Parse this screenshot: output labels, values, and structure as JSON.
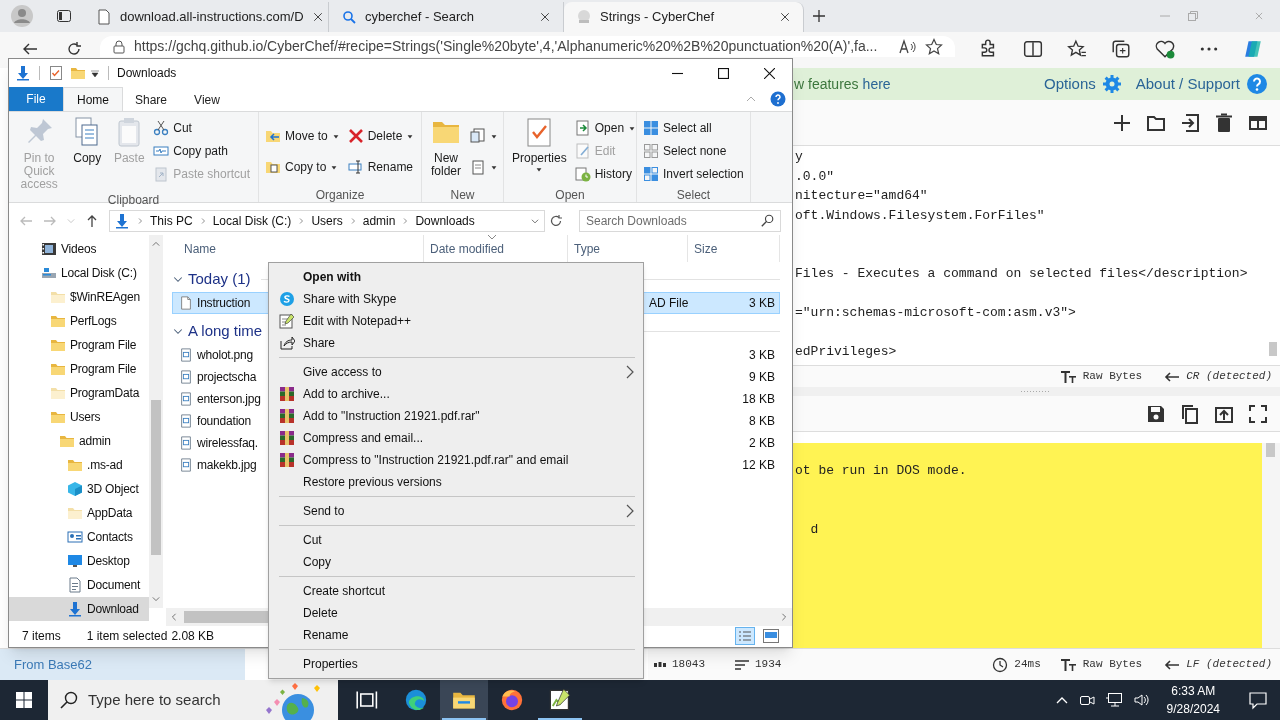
{
  "browser": {
    "tabs": [
      {
        "title": "download.all-instructions.com/D",
        "selected": false
      },
      {
        "title": "cyberchef - Search",
        "selected": false
      },
      {
        "title": "Strings - CyberChef",
        "selected": true
      }
    ],
    "url": "https://gchq.github.io/CyberChef/#recipe=Strings('Single%20byte',4,'Alphanumeric%20%2B%20punctuation%20(A)',fa..."
  },
  "cyberchef": {
    "banner": {
      "text": "w features",
      "link": "here"
    },
    "options": "Options",
    "about": "About / Support",
    "input": {
      "text": "y\n.0.0\"\nnitecture=\"amd64\"\noft.Windows.Filesystem.ForFiles\"\n\n\nFiles - Executes a command on selected files</description>\n\n=\"urn:schemas-microsoft-com:asm.v3\">\n\nedPrivileges>"
    },
    "input_status": {
      "format": "Raw Bytes",
      "eol": "CR (detected)"
    },
    "output": {
      "text": "ot be run in DOS mode.\n\n\n  d"
    },
    "output_status": {
      "length": "18043",
      "lines": "1934",
      "time": "24ms",
      "format": "Raw Bytes",
      "eol": "LF (detected)"
    },
    "recipe_op": "From Base62"
  },
  "explorer": {
    "title": "Downloads",
    "ribbon_tabs": [
      {
        "label": "File",
        "selected": false,
        "kind": "file"
      },
      {
        "label": "Home",
        "selected": true,
        "kind": "tab"
      },
      {
        "label": "Share",
        "selected": false,
        "kind": "tab"
      },
      {
        "label": "View",
        "selected": false,
        "kind": "tab"
      }
    ],
    "groups": [
      {
        "label": "Clipboard",
        "items": [
          {
            "label": "Pin to Quick access",
            "kind": "large",
            "disabled": true,
            "dropdown": false
          },
          {
            "label": "Copy",
            "kind": "large",
            "disabled": false,
            "dropdown": false
          },
          {
            "label": "Paste",
            "kind": "large",
            "disabled": true,
            "dropdown": false
          },
          {
            "label": "Cut",
            "kind": "small",
            "disabled": false,
            "dropdown": false
          },
          {
            "label": "Copy path",
            "kind": "small",
            "disabled": false,
            "dropdown": false
          },
          {
            "label": "Paste shortcut",
            "kind": "small",
            "disabled": true,
            "dropdown": false
          }
        ]
      },
      {
        "label": "Organize",
        "items": [
          {
            "label": "Move to",
            "kind": "small",
            "disabled": false,
            "dropdown": true
          },
          {
            "label": "Copy to",
            "kind": "small",
            "disabled": false,
            "dropdown": true
          },
          {
            "label": "Delete",
            "kind": "small",
            "disabled": false,
            "dropdown": true
          },
          {
            "label": "Rename",
            "kind": "small",
            "disabled": false,
            "dropdown": false
          }
        ]
      },
      {
        "label": "New",
        "items": [
          {
            "label": "New folder",
            "kind": "large",
            "disabled": false,
            "dropdown": false
          },
          {
            "kind": "icon",
            "disabled": false,
            "dropdown": true
          },
          {
            "kind": "icon",
            "disabled": false,
            "dropdown": true
          }
        ]
      },
      {
        "label": "Open",
        "items": [
          {
            "label": "Properties",
            "kind": "large",
            "disabled": false,
            "dropdown": true
          },
          {
            "label": "Open",
            "kind": "small",
            "disabled": false,
            "dropdown": true
          },
          {
            "label": "Edit",
            "kind": "small",
            "disabled": true,
            "dropdown": false
          },
          {
            "label": "History",
            "kind": "small",
            "disabled": false,
            "dropdown": false
          }
        ]
      },
      {
        "label": "Select",
        "items": [
          {
            "label": "Select all",
            "kind": "small",
            "disabled": false,
            "dropdown": false
          },
          {
            "label": "Select none",
            "kind": "small",
            "disabled": false,
            "dropdown": false
          },
          {
            "label": "Invert selection",
            "kind": "small",
            "disabled": false,
            "dropdown": false
          }
        ]
      }
    ],
    "path": [
      "This PC",
      "Local Disk (C:)",
      "Users",
      "admin",
      "Downloads"
    ],
    "search": {
      "placeholder": "Search Downloads"
    },
    "tree": [
      {
        "label": "Videos",
        "selected": false,
        "hidden": false
      },
      {
        "label": "Local Disk (C:)",
        "selected": false,
        "hidden": false,
        "children": [
          {
            "label": "$WinREAgen",
            "selected": false,
            "hidden": true
          },
          {
            "label": "PerfLogs",
            "selected": false,
            "hidden": false
          },
          {
            "label": "Program File",
            "selected": false,
            "hidden": false
          },
          {
            "label": "Program File",
            "selected": false,
            "hidden": false
          },
          {
            "label": "ProgramData",
            "selected": false,
            "hidden": true
          },
          {
            "label": "Users",
            "selected": false,
            "hidden": false,
            "children": [
              {
                "label": "admin",
                "selected": false,
                "hidden": false,
                "children": [
                  {
                    "label": ".ms-ad",
                    "selected": false,
                    "hidden": false
                  },
                  {
                    "label": "3D Object",
                    "selected": false,
                    "hidden": false
                  },
                  {
                    "label": "AppData",
                    "selected": false,
                    "hidden": true
                  },
                  {
                    "label": "Contacts",
                    "selected": false,
                    "hidden": false
                  },
                  {
                    "label": "Desktop",
                    "selected": false,
                    "hidden": false
                  },
                  {
                    "label": "Document",
                    "selected": false,
                    "hidden": false
                  },
                  {
                    "label": "Download",
                    "selected": true,
                    "hidden": false
                  }
                ]
              }
            ]
          }
        ]
      }
    ],
    "columns": [
      "Name",
      "Date modified",
      "Type",
      "Size"
    ],
    "file_groups": [
      {
        "label": "Today (1)",
        "rows": [
          {
            "name": "Instruction",
            "type": "AD File",
            "size": "3 KB",
            "selected": true
          }
        ]
      },
      {
        "label": "A long time",
        "rows": [
          {
            "name": "wholot.png",
            "size": "3 KB",
            "selected": false
          },
          {
            "name": "projectscha",
            "size": "9 KB",
            "selected": false
          },
          {
            "name": "enterson.jpg",
            "size": "18 KB",
            "selected": false
          },
          {
            "name": "foundation",
            "size": "8 KB",
            "selected": false
          },
          {
            "name": "wirelessfaq.",
            "size": "2 KB",
            "selected": false
          },
          {
            "name": "makekb.jpg",
            "size": "12 KB",
            "selected": false
          }
        ]
      }
    ],
    "status": {
      "count": "7 items",
      "selection": "1 item selected",
      "size": "2.08 KB"
    }
  },
  "context_menu": [
    {
      "kind": "item",
      "label": "Open with",
      "default": true,
      "submenu": false
    },
    {
      "kind": "item",
      "label": "Share with Skype",
      "default": false,
      "submenu": false
    },
    {
      "kind": "item",
      "label": "Edit with Notepad++",
      "default": false,
      "submenu": false
    },
    {
      "kind": "item",
      "label": "Share",
      "default": false,
      "submenu": false
    },
    {
      "kind": "separator"
    },
    {
      "kind": "item",
      "label": "Give access to",
      "default": false,
      "submenu": true
    },
    {
      "kind": "item",
      "label": "Add to archive...",
      "default": false,
      "submenu": false
    },
    {
      "kind": "item",
      "label": "Add to \"Instruction 21921.pdf.rar\"",
      "default": false,
      "submenu": false
    },
    {
      "kind": "item",
      "label": "Compress and email...",
      "default": false,
      "submenu": false
    },
    {
      "kind": "item",
      "label": "Compress to \"Instruction 21921.pdf.rar\" and email",
      "default": false,
      "submenu": false
    },
    {
      "kind": "item",
      "label": "Restore previous versions",
      "default": false,
      "submenu": false
    },
    {
      "kind": "separator"
    },
    {
      "kind": "item",
      "label": "Send to",
      "default": false,
      "submenu": true
    },
    {
      "kind": "separator"
    },
    {
      "kind": "item",
      "label": "Cut",
      "default": false,
      "submenu": false
    },
    {
      "kind": "item",
      "label": "Copy",
      "default": false,
      "submenu": false
    },
    {
      "kind": "separator"
    },
    {
      "kind": "item",
      "label": "Create shortcut",
      "default": false,
      "submenu": false
    },
    {
      "kind": "item",
      "label": "Delete",
      "default": false,
      "submenu": false
    },
    {
      "kind": "item",
      "label": "Rename",
      "default": false,
      "submenu": false
    },
    {
      "kind": "separator"
    },
    {
      "kind": "item",
      "label": "Properties",
      "default": false,
      "submenu": false
    }
  ],
  "taskbar": {
    "search_placeholder": "Type here to search",
    "pinned": [
      {
        "active": false,
        "running": false
      },
      {
        "active": false,
        "running": false
      },
      {
        "active": true,
        "running": true
      },
      {
        "active": false,
        "running": false
      },
      {
        "active": false,
        "running": true
      }
    ],
    "time": "6:33 AM",
    "date": "9/28/2024"
  }
}
